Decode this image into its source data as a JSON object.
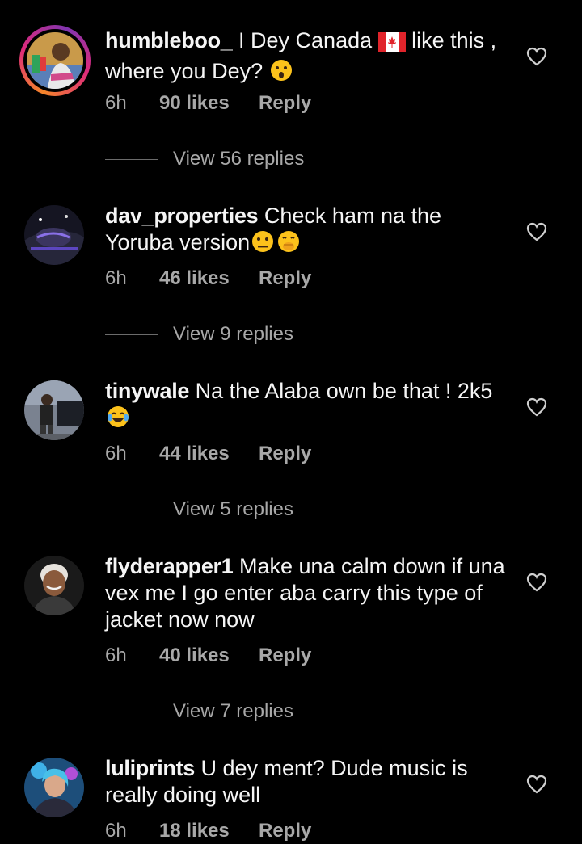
{
  "comments": [
    {
      "username": "humbleboo_",
      "text_parts": [
        "I Dey Canada ",
        " like this , where you Dey? "
      ],
      "time": "6h",
      "likes": "90 likes",
      "reply": "Reply",
      "view_replies": "View 56 replies",
      "story_ring": true
    },
    {
      "username": "dav_properties",
      "text_parts": [
        "Check ham na the Yoruba version"
      ],
      "time": "6h",
      "likes": "46 likes",
      "reply": "Reply",
      "view_replies": "View 9 replies"
    },
    {
      "username": "tinywale",
      "text_parts": [
        "Na the Alaba own be that ! 2k5 "
      ],
      "time": "6h",
      "likes": "44 likes",
      "reply": "Reply",
      "view_replies": "View 5 replies"
    },
    {
      "username": "flyderapper1",
      "text_parts": [
        "Make una calm down if una vex me I go enter aba carry this type of jacket now now"
      ],
      "time": "6h",
      "likes": "40 likes",
      "reply": "Reply",
      "view_replies": "View 7 replies"
    },
    {
      "username": "luliprints",
      "text_parts": [
        "U dey ment? Dude music is really doing well"
      ],
      "time": "6h",
      "likes": "18 likes",
      "reply": "Reply"
    }
  ],
  "icons": {
    "like": "heart-outline-icon",
    "flag": "canada-flag-emoji",
    "hushed": "hushed-face-emoji",
    "neutral": "neutral-face-emoji",
    "hand_over_mouth": "face-with-hand-over-mouth-emoji",
    "tears_of_joy": "face-with-tears-of-joy-emoji"
  },
  "colors": {
    "background": "#000000",
    "text": "#f5f5f5",
    "secondary": "#a8a8a8"
  }
}
